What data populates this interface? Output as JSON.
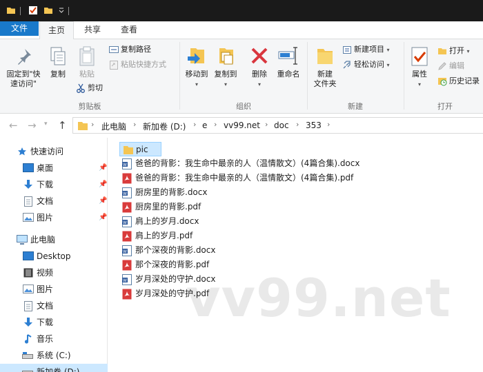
{
  "window": {
    "title_icons": [
      "folder-icon",
      "properties-check-icon",
      "new-folder-icon",
      "dropdown-icon"
    ]
  },
  "tabs": [
    {
      "label": "文件"
    },
    {
      "label": "主页"
    },
    {
      "label": "共享"
    },
    {
      "label": "查看"
    }
  ],
  "ribbon": {
    "clipboard": {
      "pin_label": "固定到\"快\n速访问\"",
      "copy_label": "复制",
      "paste_label": "粘贴",
      "copy_path_label": "复制路径",
      "paste_shortcut_label": "粘贴快捷方式",
      "cut_label": "剪切",
      "group_label": "剪贴板"
    },
    "organize": {
      "move_to_label": "移动到",
      "copy_to_label": "复制到",
      "delete_label": "删除",
      "rename_label": "重命名",
      "group_label": "组织"
    },
    "new": {
      "new_folder_label": "新建\n文件夹",
      "new_item_label": "新建项目",
      "easy_access_label": "轻松访问",
      "group_label": "新建"
    },
    "open": {
      "properties_label": "属性",
      "open_label": "打开",
      "edit_label": "编辑",
      "history_label": "历史记录",
      "group_label": "打开"
    }
  },
  "address": {
    "breadcrumbs": [
      "此电脑",
      "新加卷 (D:)",
      "e",
      "vv99.net",
      "doc",
      "353"
    ]
  },
  "nav": {
    "quick_access_label": "快速访问",
    "quick_items": [
      {
        "label": "桌面",
        "icon": "desktop-icon"
      },
      {
        "label": "下载",
        "icon": "download-icon"
      },
      {
        "label": "文档",
        "icon": "documents-icon"
      },
      {
        "label": "图片",
        "icon": "pictures-icon"
      }
    ],
    "this_pc_label": "此电脑",
    "pc_items": [
      {
        "label": "Desktop",
        "icon": "desktop-icon"
      },
      {
        "label": "视频",
        "icon": "videos-icon"
      },
      {
        "label": "图片",
        "icon": "pictures-icon"
      },
      {
        "label": "文档",
        "icon": "documents-icon"
      },
      {
        "label": "下载",
        "icon": "download-icon"
      },
      {
        "label": "音乐",
        "icon": "music-icon"
      },
      {
        "label": "系统 (C:)",
        "icon": "drive-icon"
      },
      {
        "label": "新加卷 (D:)",
        "icon": "drive-icon"
      }
    ]
  },
  "files": [
    {
      "name": "pic",
      "type": "folder"
    },
    {
      "name": "爸爸的背影：我生命中最亲的人（温情散文）(4篇合集).docx",
      "type": "docx"
    },
    {
      "name": "爸爸的背影：我生命中最亲的人（温情散文）(4篇合集).pdf",
      "type": "pdf"
    },
    {
      "name": "厨房里的背影.docx",
      "type": "docx"
    },
    {
      "name": "厨房里的背影.pdf",
      "type": "pdf"
    },
    {
      "name": "肩上的岁月.docx",
      "type": "docx"
    },
    {
      "name": "肩上的岁月.pdf",
      "type": "pdf"
    },
    {
      "name": "那个深夜的背影.docx",
      "type": "docx"
    },
    {
      "name": "那个深夜的背影.pdf",
      "type": "pdf"
    },
    {
      "name": "岁月深处的守护.docx",
      "type": "docx"
    },
    {
      "name": "岁月深处的守护.pdf",
      "type": "pdf"
    }
  ],
  "watermark": "vv99.net",
  "colors": {
    "accent": "#1979ca",
    "selection": "#cce8ff",
    "folder": "#f4c553",
    "pdf": "#d93b3b",
    "word": "#2b579a"
  }
}
